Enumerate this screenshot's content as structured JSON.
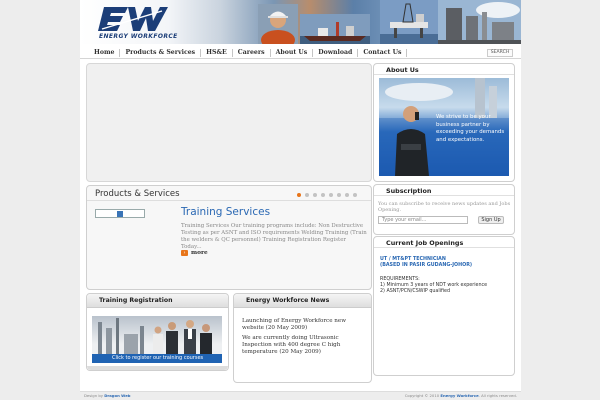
{
  "brand": {
    "logo_text": "ENERGY WORKFORCE"
  },
  "nav": {
    "items": [
      "Home",
      "Products & Services",
      "HS&E",
      "Careers",
      "About Us",
      "Download",
      "Contact Us"
    ],
    "search_label": "SEARCH"
  },
  "products": {
    "title": "Products & Services",
    "slide_count": 8,
    "active_slide": 1,
    "heading": "Training Services",
    "description": "Training Services Our training programs include: Non Destructive Testing as per ASNT and ISO requirements Welding Training (Train the welders & QC personnel) Training Registration Register Today...",
    "more_label": "more"
  },
  "about": {
    "title": "About Us",
    "tagline": "We strive to be your business partner by exceeding your demands and expectations."
  },
  "subscription": {
    "title": "Subscription",
    "text": "You can subscribe to receive news updates and Jobs Opening.",
    "email_placeholder": "Type your email...",
    "button_label": "Sign Up"
  },
  "jobs": {
    "title": "Current Job Openings",
    "job_title_line1": "UT / MT&PT TECHNICIAN",
    "job_title_line2": "(BASED IN PASIR GUDANG-JOHOR)",
    "req_heading": "REQUIREMENTS:",
    "req_1": "1) Minimum 3 years of NDT work experience",
    "req_2": "2) ASNT/PCN/CSWIP qualified"
  },
  "training": {
    "title": "Training Registration",
    "banner_text": "Click to register our training courses"
  },
  "news": {
    "title": "Energy Workforce News",
    "items": [
      "Launching of Energy Workforce new website (20 May 2009)",
      "We are currently doing Ultrasonic Inspection with 400 degree C high temperature (20 May 2009)"
    ]
  },
  "footer": {
    "left_prefix": "Design by",
    "left_link": "Dragon Web",
    "right_prefix": "Copyright © 2010",
    "right_link": "Energy Workforce",
    "right_suffix": ". All rights reserved."
  },
  "colors": {
    "accent": "#2a68b3",
    "brand": "#1c3e78",
    "highlight": "#e8751a"
  }
}
